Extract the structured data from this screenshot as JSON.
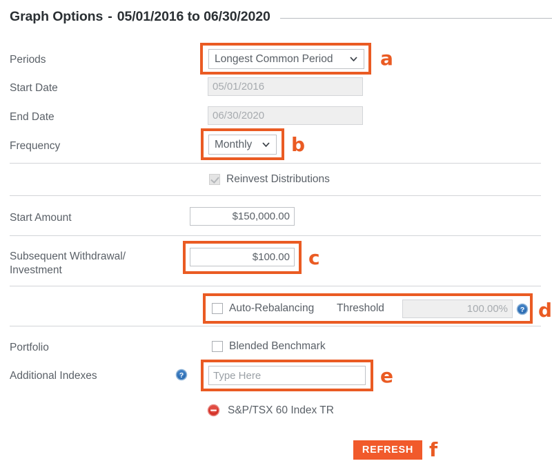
{
  "header": {
    "title": "Graph Options",
    "separator": "-",
    "date_range": "05/01/2016 to 06/30/2020"
  },
  "fields": {
    "periods": {
      "label": "Periods",
      "value": "Longest Common Period",
      "chevron_icon": "chevron-down-icon"
    },
    "start_date": {
      "label": "Start Date",
      "value": "05/01/2016"
    },
    "end_date": {
      "label": "End Date",
      "value": "06/30/2020"
    },
    "frequency": {
      "label": "Frequency",
      "value": "Monthly",
      "chevron_icon": "chevron-down-icon"
    },
    "reinvest": {
      "label": "Reinvest Distributions",
      "checked": "true"
    },
    "start_amount": {
      "label": "Start Amount",
      "value": "$150,000.00"
    },
    "subsequent": {
      "label": "Subsequent Withdrawal/\nInvestment",
      "value": "$100.00"
    },
    "auto_rebalancing": {
      "label": "Auto-Rebalancing",
      "checked": "false"
    },
    "threshold": {
      "label": "Threshold",
      "value": "100.00%",
      "help_icon": "help-icon"
    },
    "portfolio": {
      "label": "Portfolio"
    },
    "blended_benchmark": {
      "label": "Blended Benchmark",
      "checked": "false"
    },
    "additional_indexes": {
      "label": "Additional Indexes",
      "placeholder": "Type Here",
      "value": "",
      "help_icon": "help-icon"
    },
    "selected_index": {
      "name": "S&P/TSX 60 Index TR",
      "remove_icon": "remove-circle-icon"
    }
  },
  "actions": {
    "refresh_label": "REFRESH"
  },
  "annotations": {
    "a": "a",
    "b": "b",
    "c": "c",
    "d": "d",
    "e": "e",
    "f": "f"
  },
  "colors": {
    "accent_orange": "#ea5b23",
    "button_orange": "#f15a2b",
    "label_grey": "#5a6067",
    "divider_grey": "#d2d4d7",
    "help_blue": "#3a7ac0",
    "remove_red": "#d9342b"
  }
}
